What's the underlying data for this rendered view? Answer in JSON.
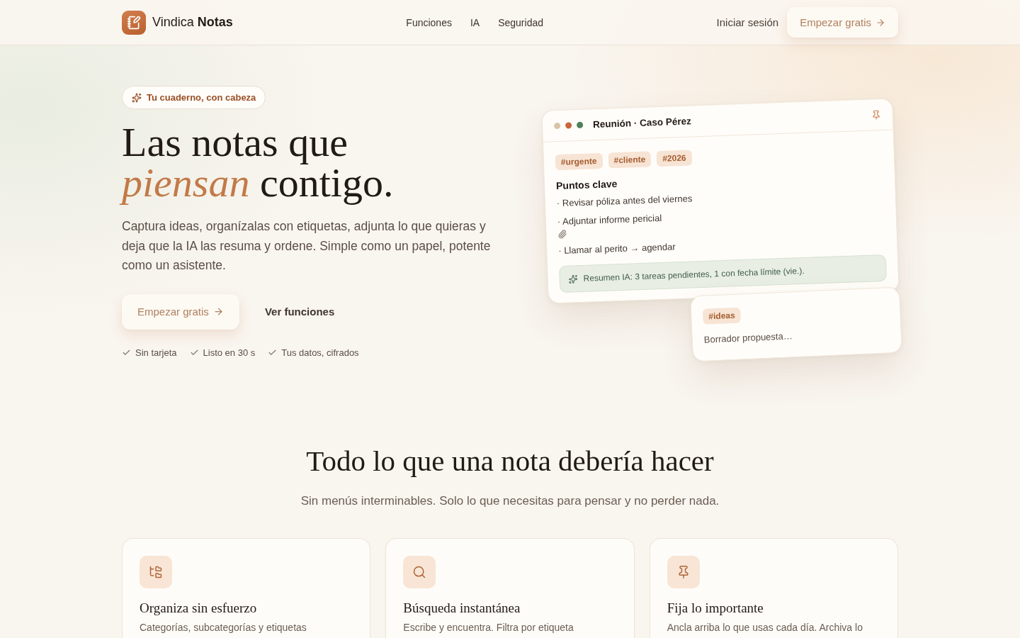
{
  "header": {
    "brand": "Vindica **Notas**",
    "nav": [
      {
        "label": "Funciones"
      },
      {
        "label": "IA"
      },
      {
        "label": "Seguridad"
      }
    ],
    "login": "Iniciar sesión",
    "cta": "Empezar gratis"
  },
  "hero": {
    "badge": "Tu cuaderno, con cabeza",
    "title_lines": [
      "Las notas que",
      "*piensan* contigo."
    ],
    "description": "Captura ideas, organízalas con etiquetas, adjunta lo que quieras y deja que la IA las resuma y ordene. Simple como un papel, potente como un asistente.",
    "primary_button": "Empezar gratis",
    "secondary_button": "Ver funciones",
    "perks": [
      "Sin tarjeta",
      "Listo en 30 s",
      "Tus datos, cifrados"
    ]
  },
  "note_preview": {
    "window_dots": [
      {
        "color": "#d8c4a8"
      },
      {
        "color": "#c8663c"
      },
      {
        "color": "#4f7f59"
      }
    ],
    "title": "Reunión · Caso Pérez",
    "tags": [
      "#urgente",
      "#cliente",
      "#2026"
    ],
    "section_title": "Puntos clave",
    "items": [
      {
        "text": "· Revisar póliza antes del viernes",
        "attachment": false
      },
      {
        "text": "· Adjuntar informe pericial",
        "attachment": true
      },
      {
        "text": "· Llamar al perito → agendar",
        "attachment": false
      }
    ],
    "ai_summary": "Resumen IA: 3 tareas pendientes, 1 con fecha límite (vie.)."
  },
  "secondary_note": {
    "tags": [
      "#ideas"
    ],
    "text": "Borrador propuesta…"
  },
  "features": {
    "title": "Todo lo que una nota debería hacer",
    "subtitle": "Sin menús interminables. Solo lo que necesitas para pensar y no perder nada.",
    "cards": [
      {
        "title": "Organiza sin esfuerzo",
        "description": "Categorías, subcategorías y etiquetas"
      },
      {
        "title": "Búsqueda instantánea",
        "description": "Escribe y encuentra. Filtra por etiqueta"
      },
      {
        "title": "Fija lo importante",
        "description": "Ancla arriba lo que usas cada día. Archiva lo"
      }
    ]
  }
}
